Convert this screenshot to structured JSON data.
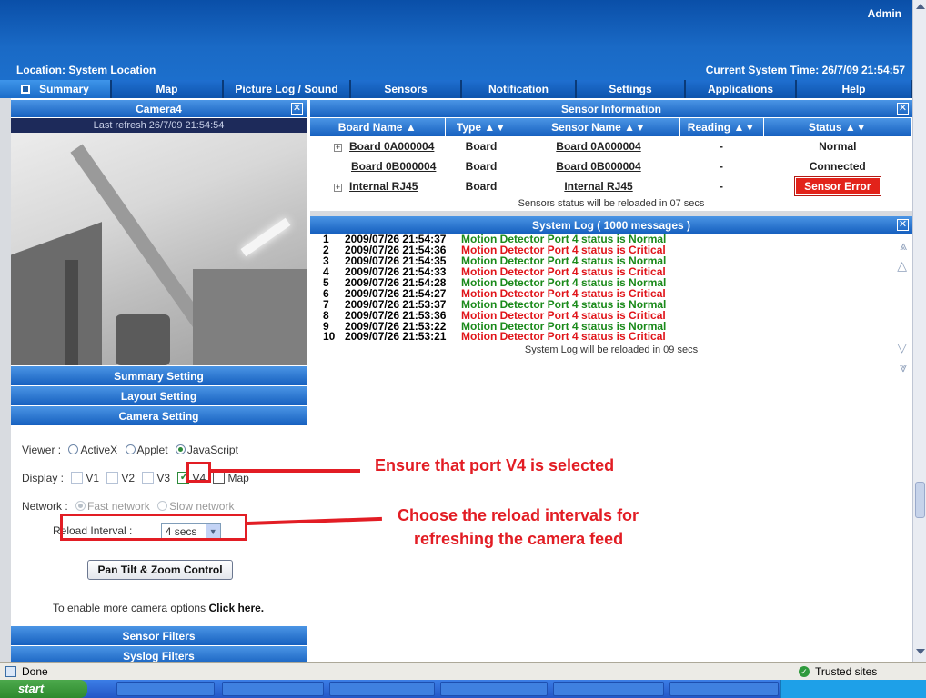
{
  "header": {
    "user": "Admin",
    "location": "Location: System Location",
    "time": "Current System Time: 26/7/09 21:54:57"
  },
  "tabs": [
    "Summary",
    "Map",
    "Picture Log / Sound Log",
    "Sensors",
    "Notification",
    "Settings",
    "Applications",
    "Help"
  ],
  "camera": {
    "title": "Camera4",
    "refresh": "Last refresh 26/7/09 21:54:54"
  },
  "left_sections": {
    "summary": "Summary Setting",
    "layout": "Layout Setting",
    "camera": "Camera Setting",
    "sensor_filters": "Sensor Filters",
    "syslog_filters": "Syslog Filters"
  },
  "camera_setting": {
    "viewer_label": "Viewer :",
    "viewer_options": [
      "ActiveX",
      "Applet",
      "JavaScript"
    ],
    "display_label": "Display :",
    "display_options": [
      "V1",
      "V2",
      "V3",
      "V4",
      "Map"
    ],
    "network_label": "Network :",
    "network_options": [
      "Fast network",
      "Slow network"
    ],
    "reload_label": "Reload Interval :",
    "reload_value": "4 secs",
    "ptz_button": "Pan Tilt & Zoom Control",
    "more_prefix": "To enable more camera options ",
    "more_link": "Click here."
  },
  "sensor_info": {
    "title": "Sensor Information",
    "columns": [
      "Board Name ▲",
      "Type ▲▼",
      "Sensor Name ▲▼",
      "Reading ▲▼",
      "Status ▲▼"
    ],
    "rows": [
      {
        "board": "Board 0A000004",
        "type": "Board",
        "sensor": "Board 0A000004",
        "reading": "-",
        "status": "Normal"
      },
      {
        "board": "Board 0B000004",
        "type": "Board",
        "sensor": "Board 0B000004",
        "reading": "-",
        "status": "Connected"
      },
      {
        "board": "Internal RJ45",
        "type": "Board",
        "sensor": "Internal RJ45",
        "reading": "-",
        "status": "Sensor Error"
      }
    ],
    "note": "Sensors status will be reloaded in 07 secs"
  },
  "system_log": {
    "title": "System Log ( 1000 messages )",
    "entries": [
      {
        "n": "1",
        "time": "2009/07/26 21:54:37",
        "msg": "Motion Detector Port 4 status is Normal",
        "level": "normal"
      },
      {
        "n": "2",
        "time": "2009/07/26 21:54:36",
        "msg": "Motion Detector Port 4 status is Critical",
        "level": "critical"
      },
      {
        "n": "3",
        "time": "2009/07/26 21:54:35",
        "msg": "Motion Detector Port 4 status is Normal",
        "level": "normal"
      },
      {
        "n": "4",
        "time": "2009/07/26 21:54:33",
        "msg": "Motion Detector Port 4 status is Critical",
        "level": "critical"
      },
      {
        "n": "5",
        "time": "2009/07/26 21:54:28",
        "msg": "Motion Detector Port 4 status is Normal",
        "level": "normal"
      },
      {
        "n": "6",
        "time": "2009/07/26 21:54:27",
        "msg": "Motion Detector Port 4 status is Critical",
        "level": "critical"
      },
      {
        "n": "7",
        "time": "2009/07/26 21:53:37",
        "msg": "Motion Detector Port 4 status is Normal",
        "level": "normal"
      },
      {
        "n": "8",
        "time": "2009/07/26 21:53:36",
        "msg": "Motion Detector Port 4 status is Critical",
        "level": "critical"
      },
      {
        "n": "9",
        "time": "2009/07/26 21:53:22",
        "msg": "Motion Detector Port 4 status is Normal",
        "level": "normal"
      },
      {
        "n": "10",
        "time": "2009/07/26 21:53:21",
        "msg": "Motion Detector Port 4 status is Critical",
        "level": "critical"
      }
    ],
    "note": "System Log will be reloaded in 09 secs"
  },
  "annotations": {
    "a1": "Ensure that port V4 is selected",
    "a2_line1": "Choose the reload intervals for",
    "a2_line2": "refreshing the camera feed"
  },
  "statusbar": {
    "left": "Done",
    "right": "Trusted sites"
  },
  "taskbar": {
    "start": "start"
  },
  "colors": {
    "normal": "#1a8a1a",
    "critical": "#e0141a",
    "accent": "#1660bf",
    "error": "#e2231a"
  },
  "icons": {
    "close": "close-icon",
    "expand": "plus-icon",
    "done": "ie-page-icon",
    "trusted": "check-icon",
    "scroll_top": "double-up-icon",
    "scroll_up": "up-icon",
    "scroll_down": "down-icon",
    "scroll_bottom": "double-down-icon"
  }
}
